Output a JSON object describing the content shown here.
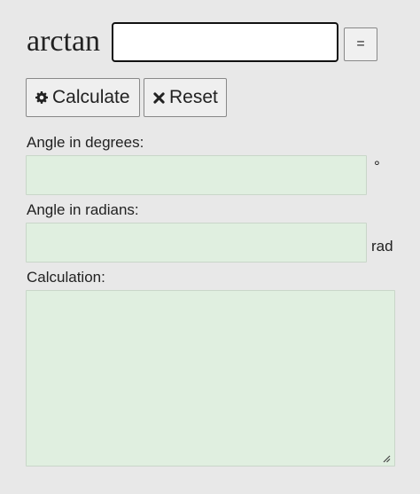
{
  "calculator": {
    "function_label": "arctan",
    "input_value": "",
    "equals_label": "="
  },
  "buttons": {
    "calculate_label": "Calculate",
    "calculate_icon": "gear-icon",
    "reset_label": "Reset",
    "reset_icon": "x-icon"
  },
  "degrees": {
    "label": "Angle in degrees:",
    "value": "",
    "unit": "°"
  },
  "radians": {
    "label": "Angle in radians:",
    "value": "",
    "unit": "rad"
  },
  "calculation": {
    "label": "Calculation:",
    "value": ""
  },
  "colors": {
    "page_background": "#e8e8e8",
    "output_field_background": "#e0efe0"
  }
}
